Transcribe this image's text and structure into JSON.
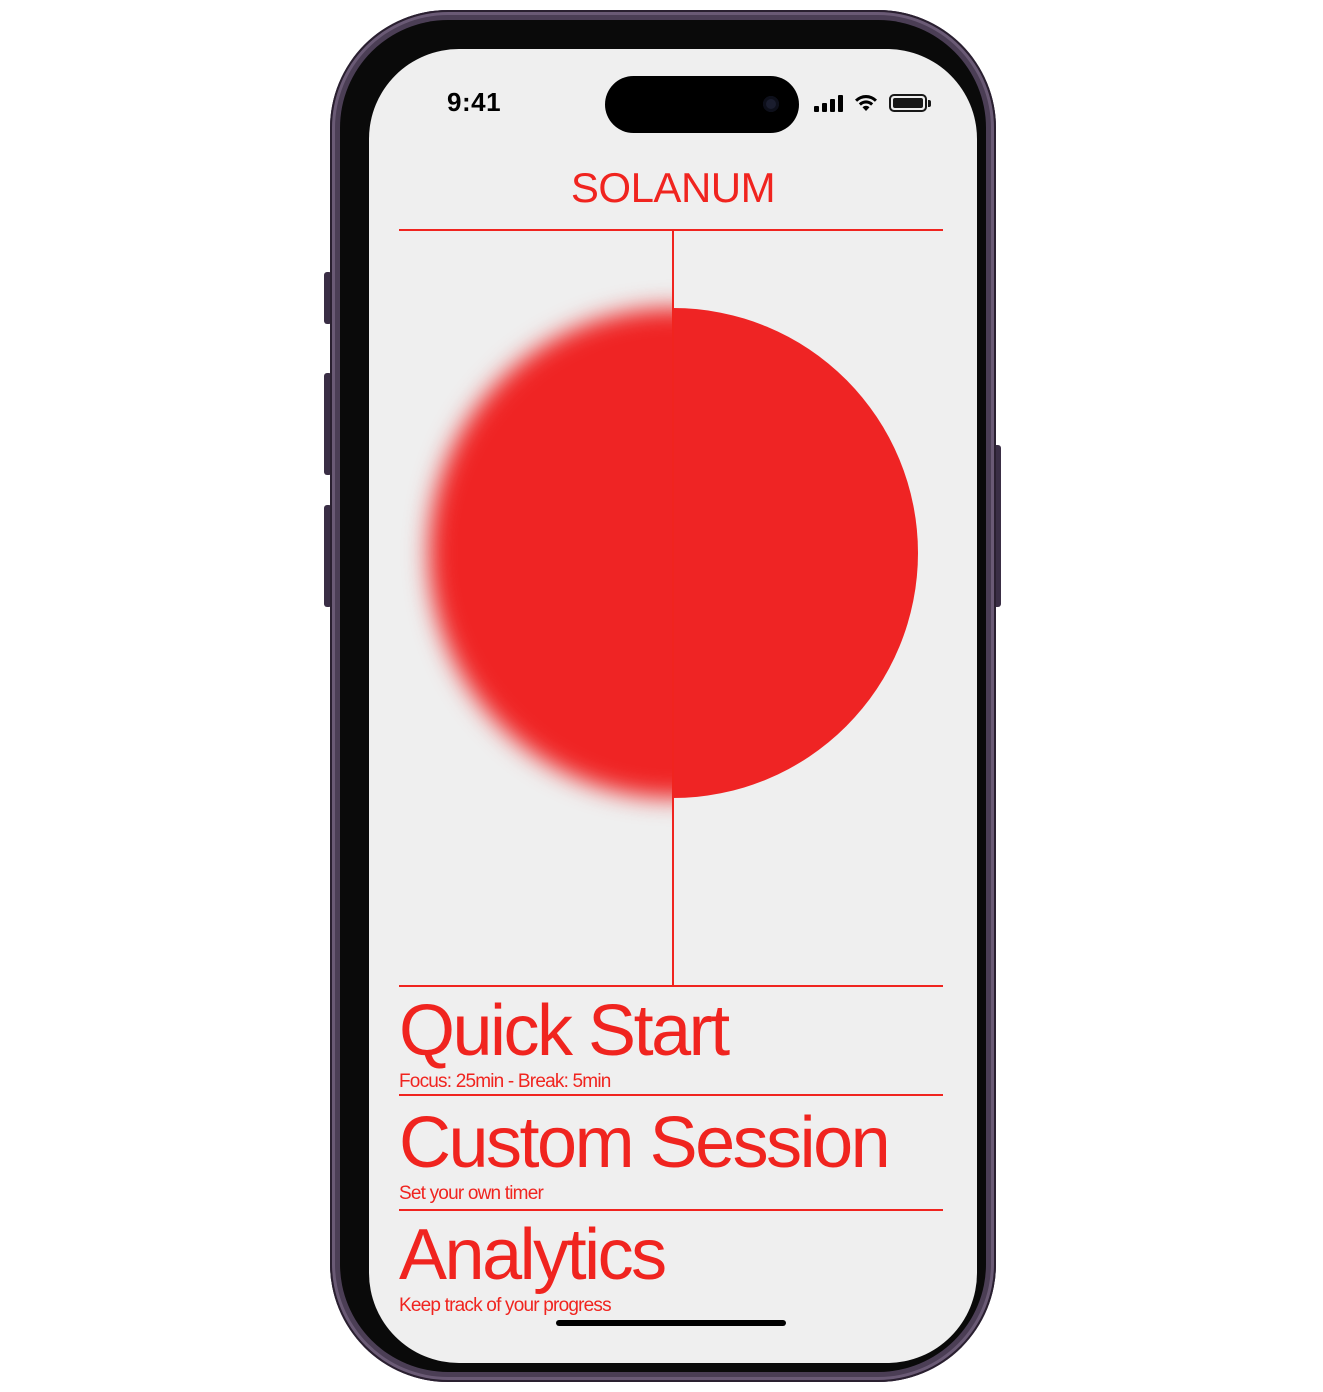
{
  "status_bar": {
    "time": "9:41",
    "signal_icon": "cellular-signal-icon",
    "wifi_icon": "wifi-icon",
    "battery_icon": "battery-icon"
  },
  "app": {
    "brand": "SOLANUM",
    "accent_color": "#f0241f",
    "background_color": "#efefef"
  },
  "menu": [
    {
      "title": "Quick Start",
      "subtitle": "Focus: 25min - Break: 5min"
    },
    {
      "title": "Custom Session",
      "subtitle": "Set your own timer"
    },
    {
      "title": "Analytics",
      "subtitle": "Keep track of your progress"
    }
  ]
}
